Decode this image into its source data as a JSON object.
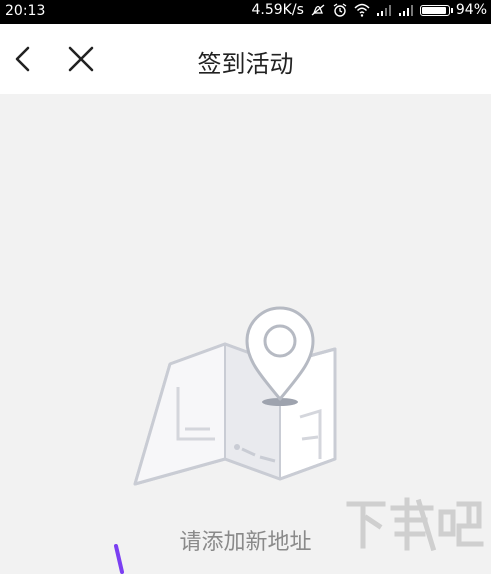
{
  "status_bar": {
    "time": "20:13",
    "network_speed": "4.59K/s",
    "battery_percent": "94%",
    "battery_level": 0.94,
    "icons": [
      "mute-icon",
      "alarm-icon",
      "wifi-icon",
      "signal-icon",
      "signal-icon",
      "battery-icon"
    ]
  },
  "nav": {
    "title": "签到活动",
    "back_icon": "chevron-left-icon",
    "close_icon": "close-icon"
  },
  "empty_state": {
    "illustration_icon": "map-pin-icon",
    "text": "请添加新地址"
  },
  "watermark": {
    "text": "下载吧"
  },
  "colors": {
    "background": "#f2f2f2",
    "nav_background": "#ffffff",
    "status_background": "#000000",
    "illustration_stroke": "#c9ccd4",
    "text_muted": "#8a8a8a",
    "accent_stroke": "#7b3ff2"
  }
}
